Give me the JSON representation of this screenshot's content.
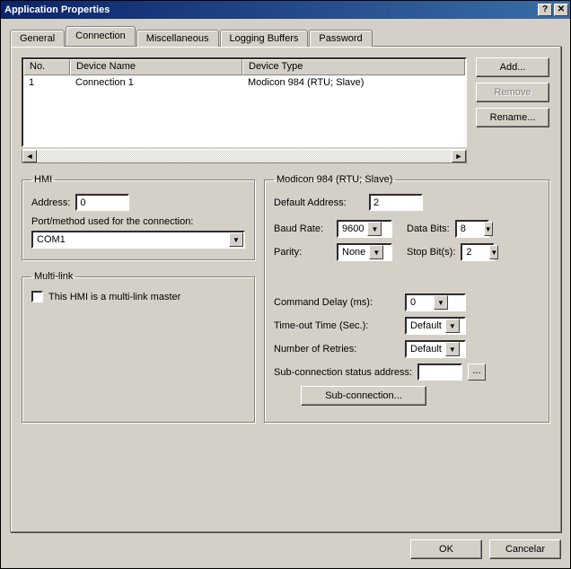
{
  "title": "Application Properties",
  "tabs": [
    "General",
    "Connection",
    "Miscellaneous",
    "Logging Buffers",
    "Password"
  ],
  "active_tab": "Connection",
  "list": {
    "headers": {
      "no": "No.",
      "device_name": "Device Name",
      "device_type": "Device Type"
    },
    "rows": [
      {
        "no": "1",
        "device_name": "Connection 1",
        "device_type": "Modicon 984 (RTU; Slave)"
      }
    ]
  },
  "buttons": {
    "add": "Add...",
    "remove": "Remove",
    "rename": "Rename...",
    "subconnection": "Sub-connection...",
    "ok": "OK",
    "cancel": "Cancelar"
  },
  "hmi": {
    "legend": "HMI",
    "address_label": "Address:",
    "address_value": "0",
    "port_label": "Port/method used for the connection:",
    "port_value": "COM1"
  },
  "multilink": {
    "legend": "Multi-link",
    "checkbox_label": "This HMI is a multi-link master"
  },
  "device": {
    "legend": "Modicon 984 (RTU; Slave)",
    "default_address_label": "Default Address:",
    "default_address_value": "2",
    "baud_label": "Baud Rate:",
    "baud_value": "9600",
    "data_bits_label": "Data Bits:",
    "data_bits_value": "8",
    "parity_label": "Parity:",
    "parity_value": "None",
    "stop_bits_label": "Stop Bit(s):",
    "stop_bits_value": "2",
    "cmd_delay_label": "Command Delay (ms):",
    "cmd_delay_value": "0",
    "timeout_label": "Time-out Time (Sec.):",
    "timeout_value": "Default",
    "retries_label": "Number of Retries:",
    "retries_value": "Default",
    "subconn_status_label": "Sub-connection status address:",
    "subconn_status_value": ""
  }
}
